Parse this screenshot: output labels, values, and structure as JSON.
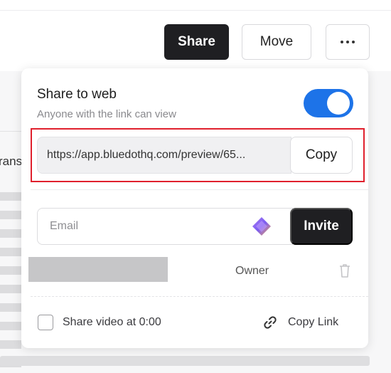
{
  "toolbar": {
    "share_label": "Share",
    "move_label": "Move",
    "more_icon": "more-horizontal-icon"
  },
  "background": {
    "partial_text": "rans"
  },
  "share_popover": {
    "title": "Share to web",
    "subtitle": "Anyone with the link can view",
    "toggle_on": true,
    "link_url": "https://app.bluedothq.com/preview/65...",
    "copy_label": "Copy",
    "email_placeholder": "Email",
    "invite_label": "Invite",
    "member": {
      "role": "Owner"
    },
    "share_video_label": "Share video at 0:00",
    "copy_link_label": "Copy Link"
  },
  "colors": {
    "accent": "#1d73e8",
    "dark_button": "#1f1f22",
    "highlight": "#e0202d"
  }
}
